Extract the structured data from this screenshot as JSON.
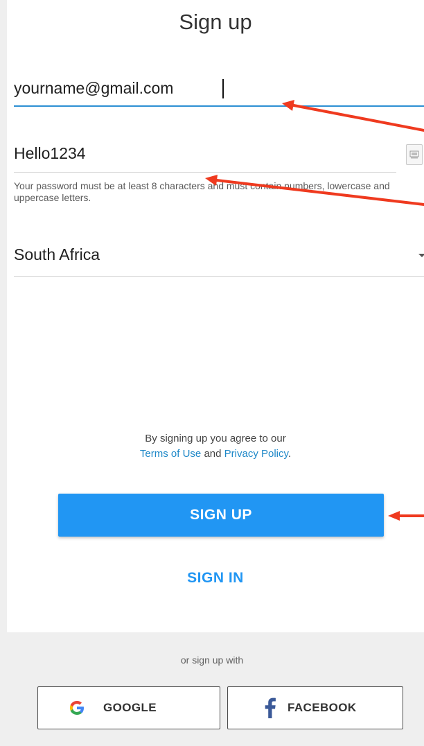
{
  "header": {
    "title": "Sign up"
  },
  "form": {
    "email_value": "yourname@gmail.com",
    "password_value": "Hello1234",
    "password_hint": "Your password must be at least 8 characters and must contain numbers, lowercase and uppercase letters.",
    "country_value": "South Africa"
  },
  "terms": {
    "prefix": "By signing up you agree to our",
    "terms_link": "Terms of Use",
    "conjunction": "and",
    "privacy_link": "Privacy Policy",
    "suffix": "."
  },
  "actions": {
    "signup_label": "SIGN UP",
    "signin_label": "SIGN IN"
  },
  "social": {
    "label": "or sign up with",
    "google_label": "GOOGLE",
    "facebook_label": "FACEBOOK"
  },
  "icons": {
    "show_password": "show-password-icon",
    "dropdown": "chevron-down-icon",
    "google": "google-icon",
    "facebook": "facebook-icon"
  },
  "colors": {
    "accent": "#2196f3",
    "link": "#1e88c8",
    "annotation": "#ef3a1f",
    "background": "#efefef"
  }
}
